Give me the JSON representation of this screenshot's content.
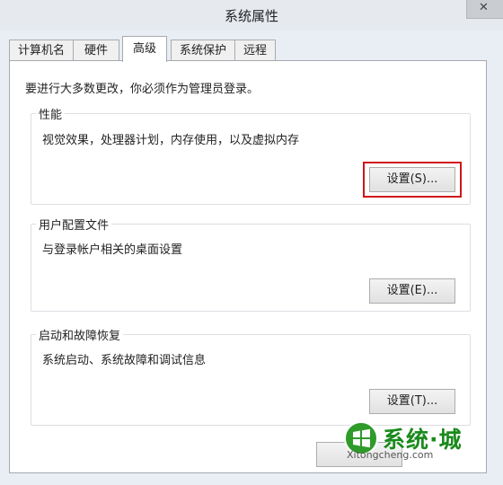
{
  "window": {
    "title": "系统属性"
  },
  "tabs": [
    {
      "label": "计算机名"
    },
    {
      "label": "硬件"
    },
    {
      "label": "高级",
      "active": true
    },
    {
      "label": "系统保护"
    },
    {
      "label": "远程"
    }
  ],
  "admin_note": "要进行大多数更改，你必须作为管理员登录。",
  "performance": {
    "title": "性能",
    "description": "视觉效果，处理器计划，内存使用，以及虚拟内存",
    "button": "设置(S)..."
  },
  "user_profiles": {
    "title": "用户配置文件",
    "description": "与登录帐户相关的桌面设置",
    "button": "设置(E)..."
  },
  "startup_recovery": {
    "title": "启动和故障恢复",
    "description": "系统启动、系统故障和调试信息",
    "button": "设置(T)..."
  },
  "watermark": {
    "text": "系统·城",
    "url": "Xitongcheng.com"
  },
  "colors": {
    "highlight": "#d0161b",
    "watermark_green": "#1a8a1c"
  }
}
